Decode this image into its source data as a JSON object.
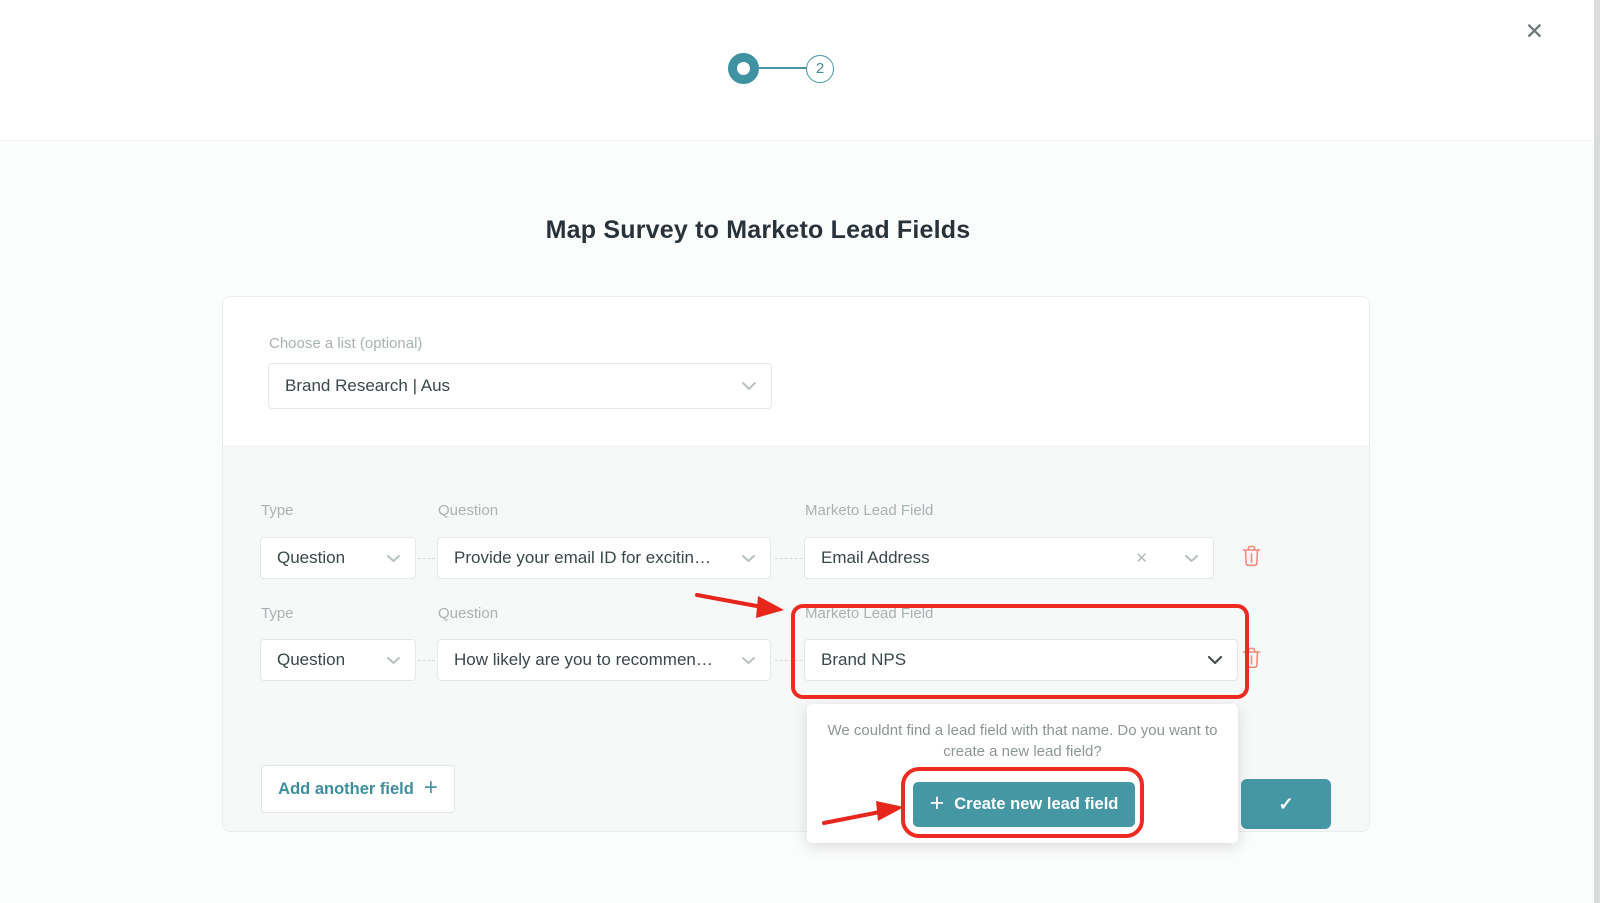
{
  "window": {
    "close_icon": "✕"
  },
  "stepper": {
    "step2_label": "2"
  },
  "page": {
    "title": "Map Survey to Marketo Lead Fields"
  },
  "list_picker": {
    "label": "Choose a list (optional)",
    "value": "Brand Research | Aus"
  },
  "labels": {
    "type": "Type",
    "question": "Question",
    "lead_field": "Marketo Lead Field"
  },
  "rows": [
    {
      "type": "Question",
      "question": "Provide your email ID for excitin…",
      "lead_field": "Email Address"
    },
    {
      "type": "Question",
      "question": "How likely are you to recommen…",
      "lead_field": "Brand NPS"
    }
  ],
  "popover": {
    "message_line1": "We couldnt find a lead field with that name. Do you want to",
    "message_line2": "create a new lead field?",
    "create_button_label": "Create new lead field"
  },
  "actions": {
    "add_field_label": "Add another field"
  },
  "icons": {
    "close": "✕",
    "clear": "✕",
    "check": "✓",
    "plus": "+",
    "chevron_down": "⌄",
    "trash": "🗑"
  },
  "colors": {
    "teal": "#4597A4",
    "annotation_red": "#EE2B22",
    "trash_red": "#F08C7D",
    "label_gray": "#A9B2B2",
    "value_text": "#39464A",
    "card_section_bg": "#F7F9F9"
  }
}
